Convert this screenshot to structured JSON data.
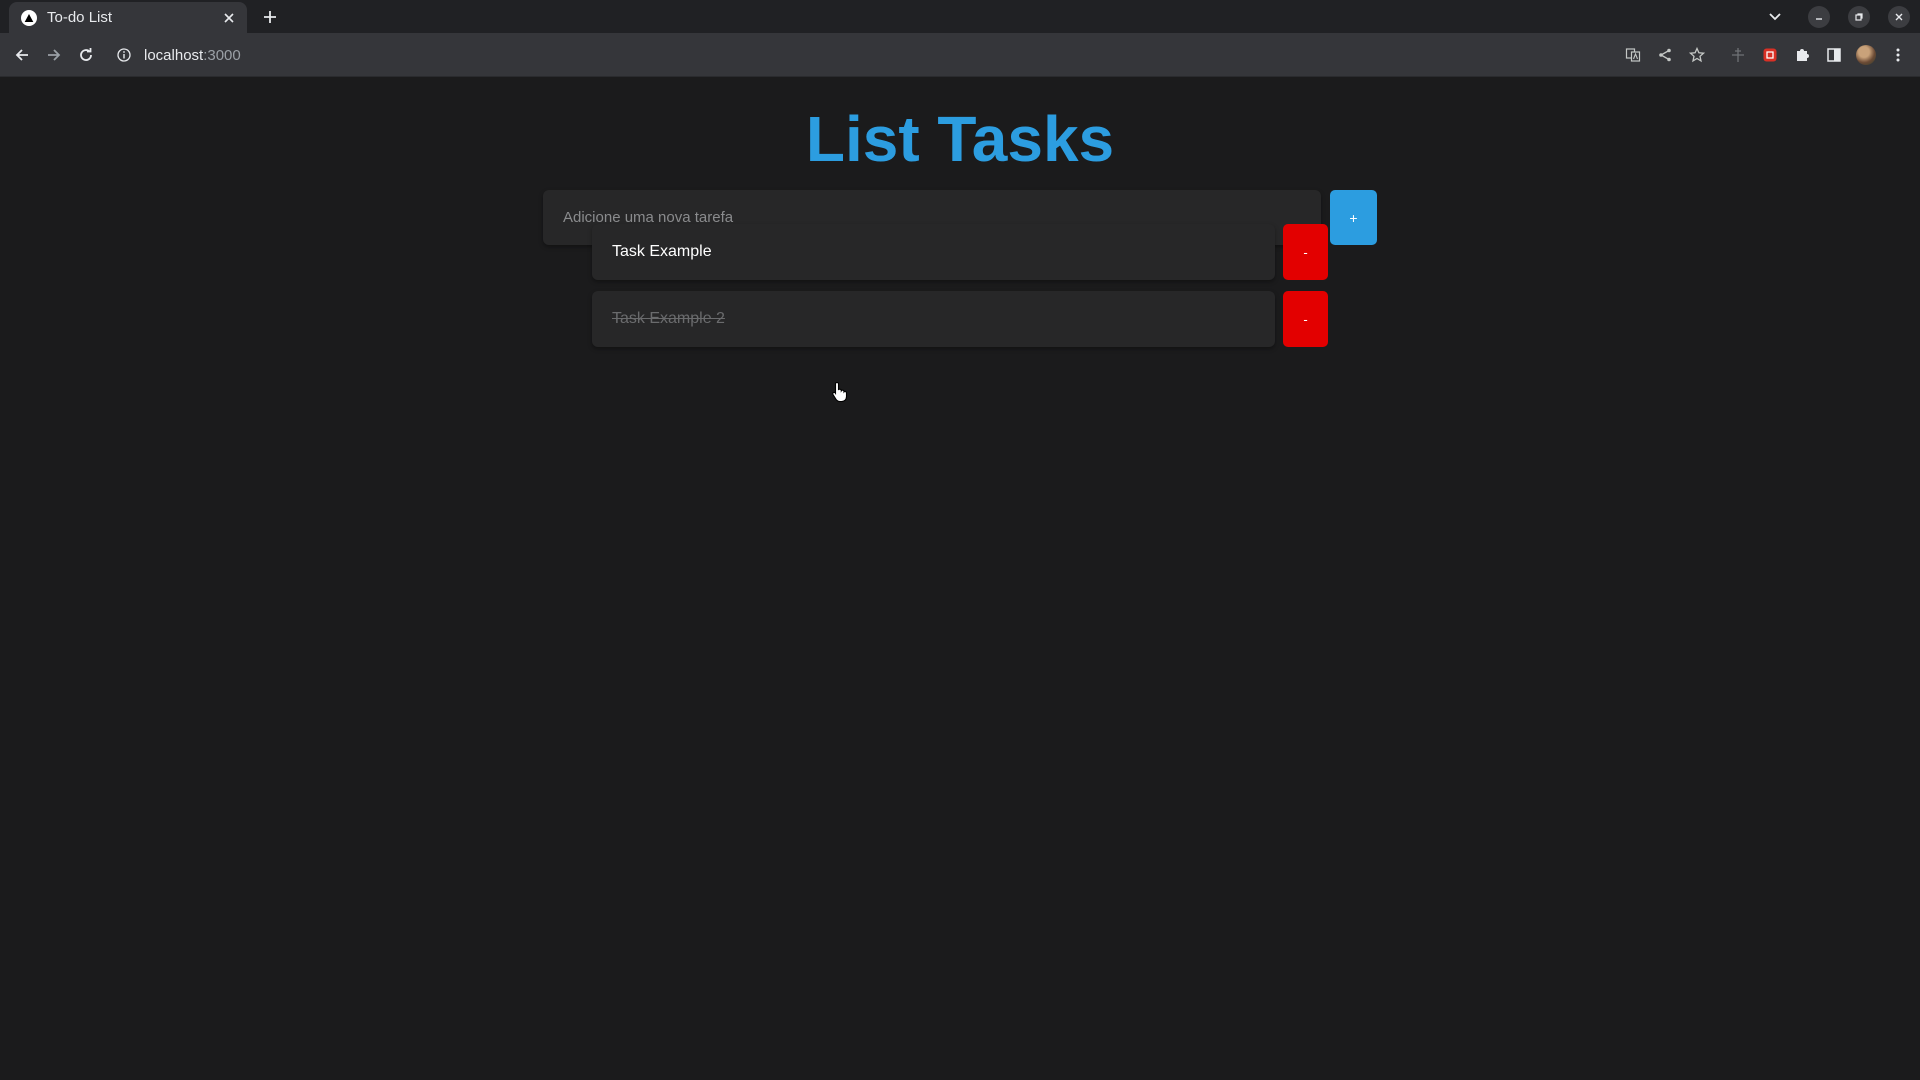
{
  "browser": {
    "tab": {
      "title": "To-do List",
      "favicon": "triangle-logo-icon"
    },
    "address": {
      "host": "localhost",
      "port": ":3000"
    },
    "toolbar_icons": [
      "back-icon",
      "forward-icon",
      "reload-icon",
      "site-info-icon",
      "translate-icon",
      "share-icon",
      "bookmark-star-icon",
      "extension-pin-icon",
      "extension-icon",
      "puzzle-icon",
      "side-panel-icon",
      "profile-avatar",
      "menu-icon"
    ]
  },
  "app": {
    "title": "List Tasks",
    "new_task": {
      "placeholder": "Adicione uma nova tarefa",
      "value": "",
      "add_label": "+"
    },
    "tasks": [
      {
        "text": "Task Example",
        "completed": false,
        "remove_label": "-"
      },
      {
        "text": "Task Example 2",
        "completed": true,
        "remove_label": "-"
      }
    ]
  },
  "colors": {
    "accent": "#2c9de0",
    "danger": "#e30000",
    "background": "#1b1b1c",
    "card": "#272728"
  }
}
